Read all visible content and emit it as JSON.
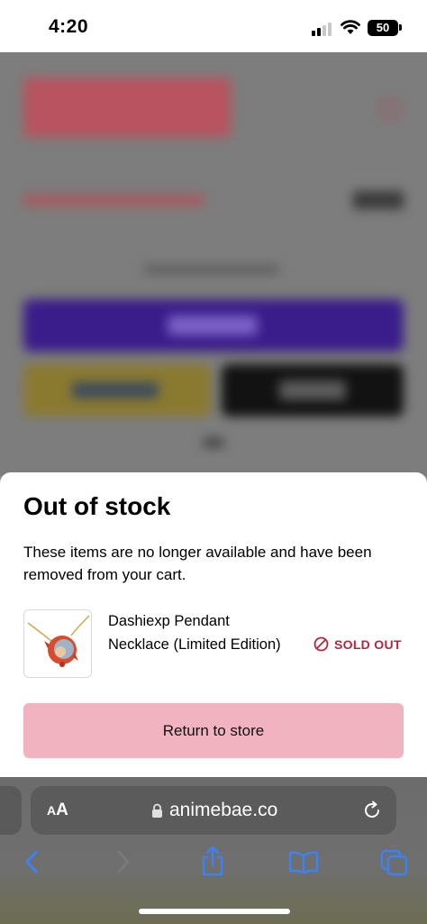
{
  "status_bar": {
    "time": "4:20",
    "battery": "50",
    "icons": [
      "signal-icon",
      "wifi-icon",
      "battery-icon"
    ]
  },
  "modal": {
    "title": "Out of stock",
    "description": "These items are no longer available and have been removed from your cart.",
    "items": [
      {
        "name": "Dashiexp Pendant Necklace (Limited Edition)",
        "status": "SOLD OUT",
        "status_icon": "prohibited-icon"
      }
    ],
    "button_label": "Return to store"
  },
  "browser": {
    "text_size_label_small": "A",
    "text_size_label_big": "A",
    "url": "animebae.co",
    "toolbar_icons": [
      "back-icon",
      "forward-icon",
      "share-icon",
      "bookmarks-icon",
      "tabs-icon"
    ]
  },
  "colors": {
    "accent_pink": "#f2b3c0",
    "sold_out_red": "#b3263f",
    "toolbar_blue": "#3b82f6"
  }
}
